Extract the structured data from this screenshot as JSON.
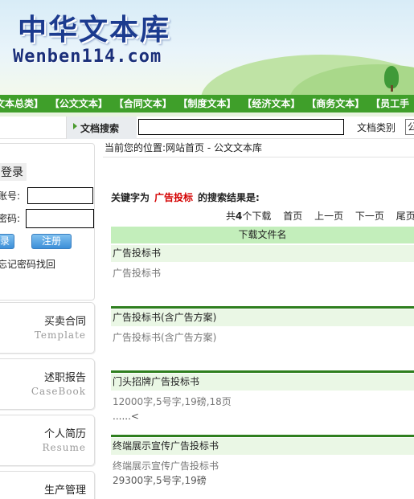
{
  "site": {
    "logo_cn": "中华文本库",
    "logo_en": "Wenben114.com"
  },
  "nav": [
    "文本总类】",
    "【公文文本】",
    "【合同文本】",
    "【制度文本】",
    "【经济文本】",
    "【商务文本】",
    "【员工手"
  ],
  "search": {
    "label": "文档搜索",
    "type_label": "文档类别",
    "type_value": "公"
  },
  "login": {
    "title": "登录",
    "account_label": "账号:",
    "password_label": "密码:",
    "login_button": "录",
    "register_button": "注册",
    "forgot": "忘记密码找回"
  },
  "categories": [
    {
      "cn": "买卖合同",
      "en": "Template"
    },
    {
      "cn": "述职报告",
      "en": "CaseBook"
    },
    {
      "cn": "个人简历",
      "en": "Resume"
    },
    {
      "cn": "生产管理",
      "en": ""
    }
  ],
  "location": "当前您的位置:网站首页 - 公文文本库",
  "results_header": {
    "prefix": "关键字为",
    "keyword": "广告投标",
    "suffix": "的搜索结果是:"
  },
  "pager": {
    "count_pre": "共",
    "count_num": "4",
    "count_post": "个下载",
    "first": "首页",
    "prev": "上一页",
    "next": "下一页",
    "last": "尾页",
    "extra": ""
  },
  "table_header": "下载文件名",
  "results": [
    {
      "title": "广告投标书",
      "desc": "广告投标书",
      "meta": ""
    },
    {
      "title": "广告投标书(含广告方案)",
      "desc": "广告投标书(含广告方案)",
      "meta": ""
    },
    {
      "title": "门头招牌广告投标书",
      "desc": "12000字,5号字,19磅,18页",
      "meta": "......<"
    },
    {
      "title": "终端展示宣传广告投标书",
      "desc": "终端展示宣传广告投标书",
      "meta": "29300字,5号字,19磅"
    }
  ]
}
